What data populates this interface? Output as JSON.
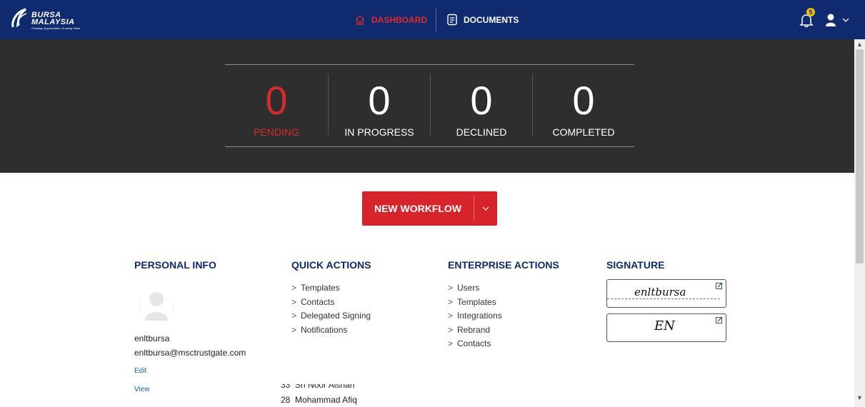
{
  "brand": {
    "name_line1": "BURSA",
    "name_line2": "MALAYSIA",
    "tagline": "Creating Opportunities, Growing Value"
  },
  "nav": {
    "dashboard": "DASHBOARD",
    "documents": "DOCUMENTS",
    "notification_count": "5"
  },
  "stats": [
    {
      "value": "0",
      "label": "PENDING"
    },
    {
      "value": "0",
      "label": "IN PROGRESS"
    },
    {
      "value": "0",
      "label": "DECLINED"
    },
    {
      "value": "0",
      "label": "COMPLETED"
    }
  ],
  "new_workflow": {
    "label": "NEW WORKFLOW"
  },
  "personal_info": {
    "title": "PERSONAL INFO",
    "username": "enltbursa",
    "email": "enltbursa@msctrustgate.com",
    "edit": "Edit",
    "view": "View"
  },
  "quick_actions": {
    "title": "QUICK ACTIONS",
    "items": [
      "Templates",
      "Contacts",
      "Delegated Signing",
      "Notifications"
    ]
  },
  "enterprise_actions": {
    "title": "ENTERPRISE ACTIONS",
    "items": [
      "Users",
      "Templates",
      "Integrations",
      "Rebrand",
      "Contacts"
    ]
  },
  "signature": {
    "title": "SIGNATURE",
    "full": "enltbursa",
    "initials": "EN"
  },
  "overlap_list": [
    {
      "num": "33",
      "name": "Sri Noor Aishah"
    },
    {
      "num": "28",
      "name": "Mohammad Afiq"
    }
  ],
  "colors": {
    "navbar": "#0f2a6e",
    "accent_red": "#d7242b",
    "stats_bg": "#2e2e2e",
    "badge": "#f2c200"
  }
}
